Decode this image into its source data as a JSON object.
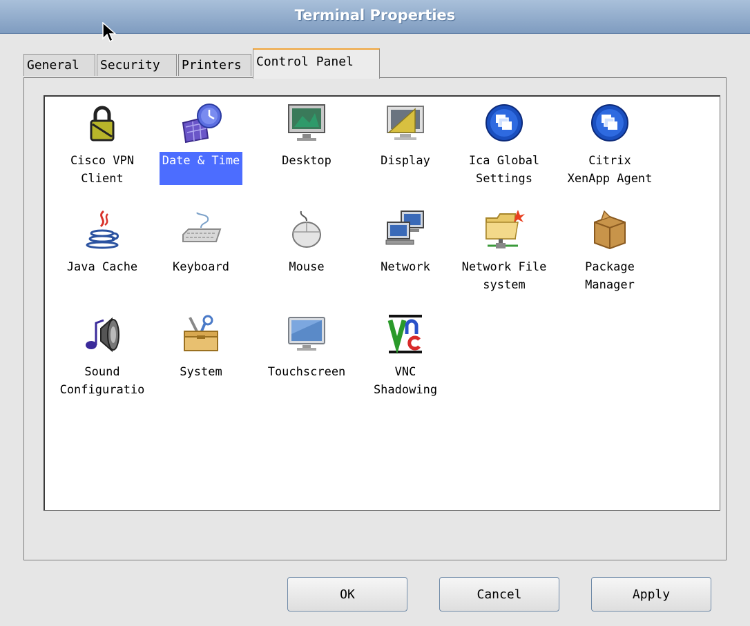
{
  "window": {
    "title": "Terminal Properties"
  },
  "tabs": [
    "General",
    "Security",
    "Printers",
    "Control Panel"
  ],
  "active_tab": "Control Panel",
  "items": [
    {
      "label": "Cisco VPN\nClient",
      "icon": "padlock-icon"
    },
    {
      "label": "Date & Time",
      "icon": "calendar-clock-icon",
      "selected": true
    },
    {
      "label": "Desktop",
      "icon": "desktop-wallpaper-icon"
    },
    {
      "label": "Display",
      "icon": "display-icon"
    },
    {
      "label": "Ica Global\nSettings",
      "icon": "citrix-icon"
    },
    {
      "label": "Citrix\nXenApp Agent",
      "icon": "citrix-icon"
    },
    {
      "label": "Java Cache",
      "icon": "java-icon"
    },
    {
      "label": "Keyboard",
      "icon": "keyboard-icon"
    },
    {
      "label": "Mouse",
      "icon": "mouse-icon"
    },
    {
      "label": "Network",
      "icon": "network-icon"
    },
    {
      "label": "Network File\nsystem",
      "icon": "network-folder-icon"
    },
    {
      "label": "Package\nManager",
      "icon": "package-icon"
    },
    {
      "label": "Sound\nConfiguratio",
      "icon": "speaker-icon"
    },
    {
      "label": "System",
      "icon": "toolbox-icon"
    },
    {
      "label": "Touchscreen",
      "icon": "touchscreen-icon"
    },
    {
      "label": "VNC\nShadowing",
      "icon": "vnc-icon"
    }
  ],
  "buttons": {
    "ok": "OK",
    "cancel": "Cancel",
    "apply": "Apply"
  },
  "colors": {
    "selection": "#4c6dff",
    "active_tab_accent": "#f0a43a",
    "titlebar": "#7f9cc0"
  }
}
